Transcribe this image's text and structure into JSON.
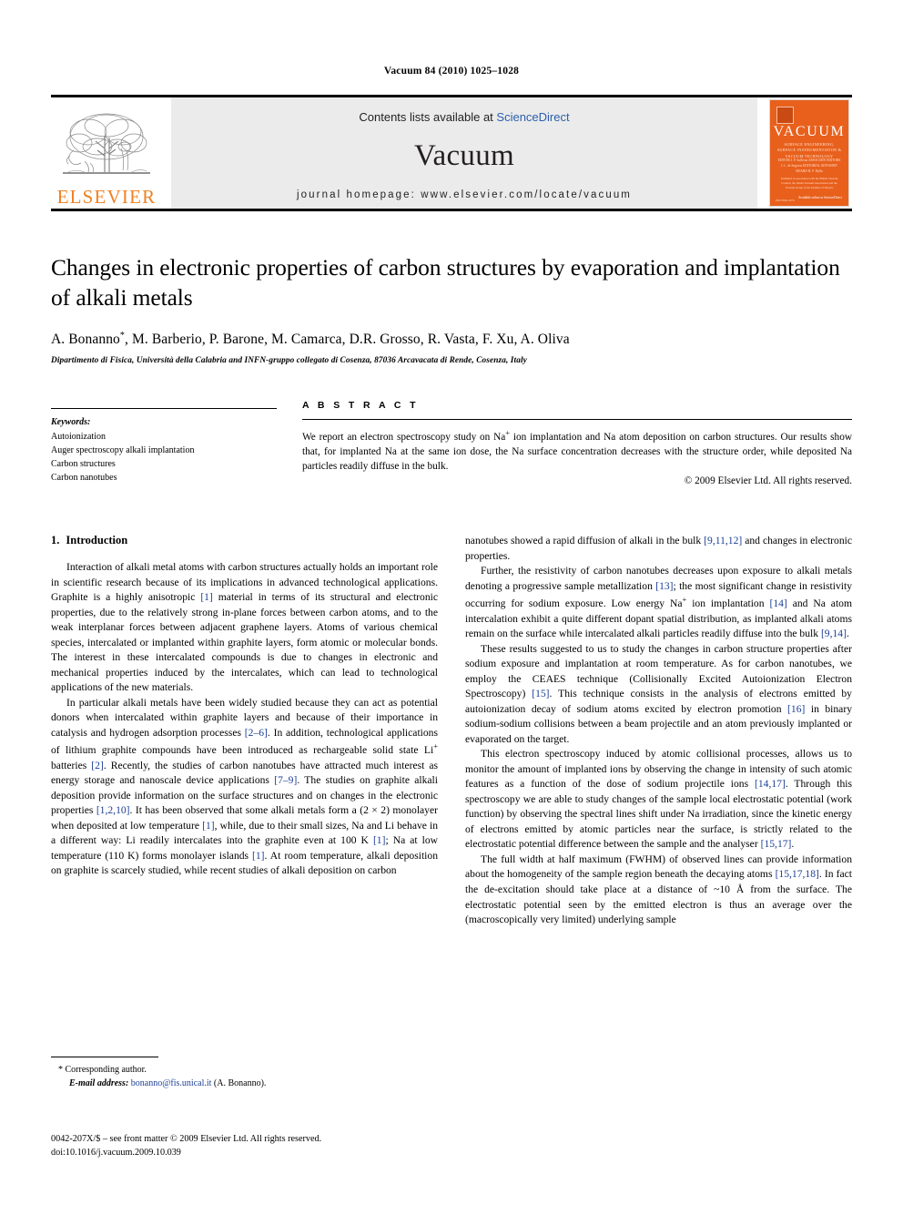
{
  "running_head": "Vacuum 84 (2010) 1025–1028",
  "masthead": {
    "publisher_name": "ELSEVIER",
    "contents_prefix": "Contents lists available at ",
    "contents_link": "ScienceDirect",
    "journal_name": "Vacuum",
    "homepage": "journal homepage: www.elsevier.com/locate/vacuum",
    "cover": {
      "title": "VACUUM",
      "subtitle": "SURFACE ENGINEERING, SURFACE INSTRUMENTATION & VACUUM TECHNOLOGY",
      "authors_line": "EDITOR  J. P. Sullivan      ASSOCIATE EDITORS      J. L. de Segovia\nEDITORIAL ADVISORY BOARD      H. F. Dylla",
      "blurb": "Published in association with the British Vacuum Council, the Italian Vacuum Association and the Vacuum Group of the Institute of Physics",
      "foot": "Available online at\nScienceDirect",
      "foot_left": "ISSN 0042-207X"
    }
  },
  "article": {
    "title": "Changes in electronic properties of carbon structures by evaporation and implantation of alkali metals",
    "authors": "A. Bonanno",
    "authors_rest": ", M. Barberio, P. Barone, M. Camarca, D.R. Grosso, R. Vasta, F. Xu, A. Oliva",
    "corresponding_marker": "*",
    "affiliation": "Dipartimento di Fisica, Università della Calabria and INFN-gruppo collegato di Cosenza, 87036 Arcavacata di Rende, Cosenza, Italy"
  },
  "keywords": {
    "heading": "Keywords:",
    "items": [
      "Autoionization",
      "Auger spectroscopy alkali implantation",
      "Carbon structures",
      "Carbon nanotubes"
    ]
  },
  "abstract": {
    "heading": "A B S T R A C T",
    "text_1": "We report an electron spectroscopy study on Na",
    "text_sup": "+",
    "text_2": " ion implantation and Na atom deposition on carbon structures. Our results show that, for implanted Na at the same ion dose, the Na surface concentration decreases with the structure order, while deposited Na particles readily diffuse in the bulk.",
    "copyright": "© 2009 Elsevier Ltd. All rights reserved."
  },
  "section": {
    "number": "1.",
    "title": "Introduction"
  },
  "paragraphs": {
    "p1_a": "Interaction of alkali metal atoms with carbon structures actually holds an important role in scientific research because of its implications in advanced technological applications. Graphite is a highly anisotropic ",
    "p1_ref1": "[1]",
    "p1_b": " material in terms of its structural and electronic properties, due to the relatively strong in-plane forces between carbon atoms, and to the weak interplanar forces between adjacent graphene layers. Atoms of various chemical species, intercalated or implanted within graphite layers, form atomic or molecular bonds. The interest in these intercalated compounds is due to changes in electronic and mechanical properties induced by the intercalates, which can lead to technological applications of the new materials.",
    "p2_a": "In particular alkali metals have been widely studied because they can act as potential donors when intercalated within graphite layers and because of their importance in catalysis and hydrogen adsorption processes ",
    "p2_ref1": "[2–6]",
    "p2_b": ". In addition, technological applications of lithium graphite compounds have been introduced as rechargeable solid state Li",
    "p2_sup": "+",
    "p2_c": " batteries ",
    "p2_ref2": "[2]",
    "p2_d": ". Recently, the studies of carbon nanotubes have attracted much interest as energy storage and nanoscale device applications ",
    "p2_ref3": "[7–9]",
    "p2_e": ". The studies on graphite alkali deposition provide information on the surface structures and on changes in the electronic properties ",
    "p2_ref4": "[1,2,10]",
    "p2_f": ". It has been observed that some alkali metals form a (2 × 2) monolayer when deposited at low temperature ",
    "p2_ref5": "[1]",
    "p2_g": ", while, due to their small sizes, Na and Li behave in a different way: Li readily intercalates into the graphite even at 100 K ",
    "p2_ref6": "[1]",
    "p2_h": "; Na at low temperature (110 K) forms monolayer islands ",
    "p2_ref7": "[1]",
    "p2_i": ". At room temperature, alkali deposition on graphite is scarcely studied, while recent studies of alkali deposition on carbon",
    "p3_a": "nanotubes showed a rapid diffusion of alkali in the bulk ",
    "p3_ref1": "[9,11,12]",
    "p3_b": " and changes in electronic properties.",
    "p4_a": "Further, the resistivity of carbon nanotubes decreases upon exposure to alkali metals denoting a progressive sample metallization ",
    "p4_ref1": "[13]",
    "p4_b": "; the most significant change in resistivity occurring for sodium exposure. Low energy Na",
    "p4_sup": "+",
    "p4_c": " ion implantation ",
    "p4_ref2": "[14]",
    "p4_d": " and Na atom intercalation exhibit a quite different dopant spatial distribution, as implanted alkali atoms remain on the surface while intercalated alkali particles readily diffuse into the bulk ",
    "p4_ref3": "[9,14]",
    "p4_e": ".",
    "p5_a": "These results suggested to us to study the changes in carbon structure properties after sodium exposure and implantation at room temperature. As for carbon nanotubes, we employ the CEAES technique (Collisionally Excited Autoionization Electron Spectroscopy) ",
    "p5_ref1": "[15]",
    "p5_b": ". This technique consists in the analysis of electrons emitted by autoionization decay of sodium atoms excited by electron promotion ",
    "p5_ref2": "[16]",
    "p5_c": " in binary sodium-sodium collisions between a beam projectile and an atom previously implanted or evaporated on the target.",
    "p6_a": "This electron spectroscopy induced by atomic collisional processes, allows us to monitor the amount of implanted ions by observing the change in intensity of such atomic features as a function of the dose of sodium projectile ions ",
    "p6_ref1": "[14,17]",
    "p6_b": ". Through this spectroscopy we are able to study changes of the sample local electrostatic potential (work function) by observing the spectral lines shift under Na irradiation, since the kinetic energy of electrons emitted by atomic particles near the surface, is strictly related to the electrostatic potential difference between the sample and the analyser ",
    "p6_ref2": "[15,17]",
    "p6_c": ".",
    "p7_a": "The full width at half maximum (FWHM) of observed lines can provide information about the homogeneity of the sample region beneath the decaying atoms ",
    "p7_ref1": "[15,17,18]",
    "p7_b": ". In fact the de-excitation should take place at a distance of ~10 Å from the surface. The electrostatic potential seen by the emitted electron is thus an average over the (macroscopically very limited) underlying sample"
  },
  "footnote": {
    "star": "*",
    "corresponding": " Corresponding author.",
    "email_label": "E-mail address:",
    "email": "bonanno@fis.unical.it",
    "email_suffix": " (A. Bonanno)."
  },
  "imprint": {
    "line1": "0042-207X/$ – see front matter © 2009 Elsevier Ltd. All rights reserved.",
    "line2": "doi:10.1016/j.vacuum.2009.10.039"
  },
  "colors": {
    "link": "#2b5fad",
    "reference": "#1c3f94",
    "elsevier_orange": "#F08122",
    "cover_orange": "#E8601C",
    "masthead_grey": "#ebebeb"
  }
}
